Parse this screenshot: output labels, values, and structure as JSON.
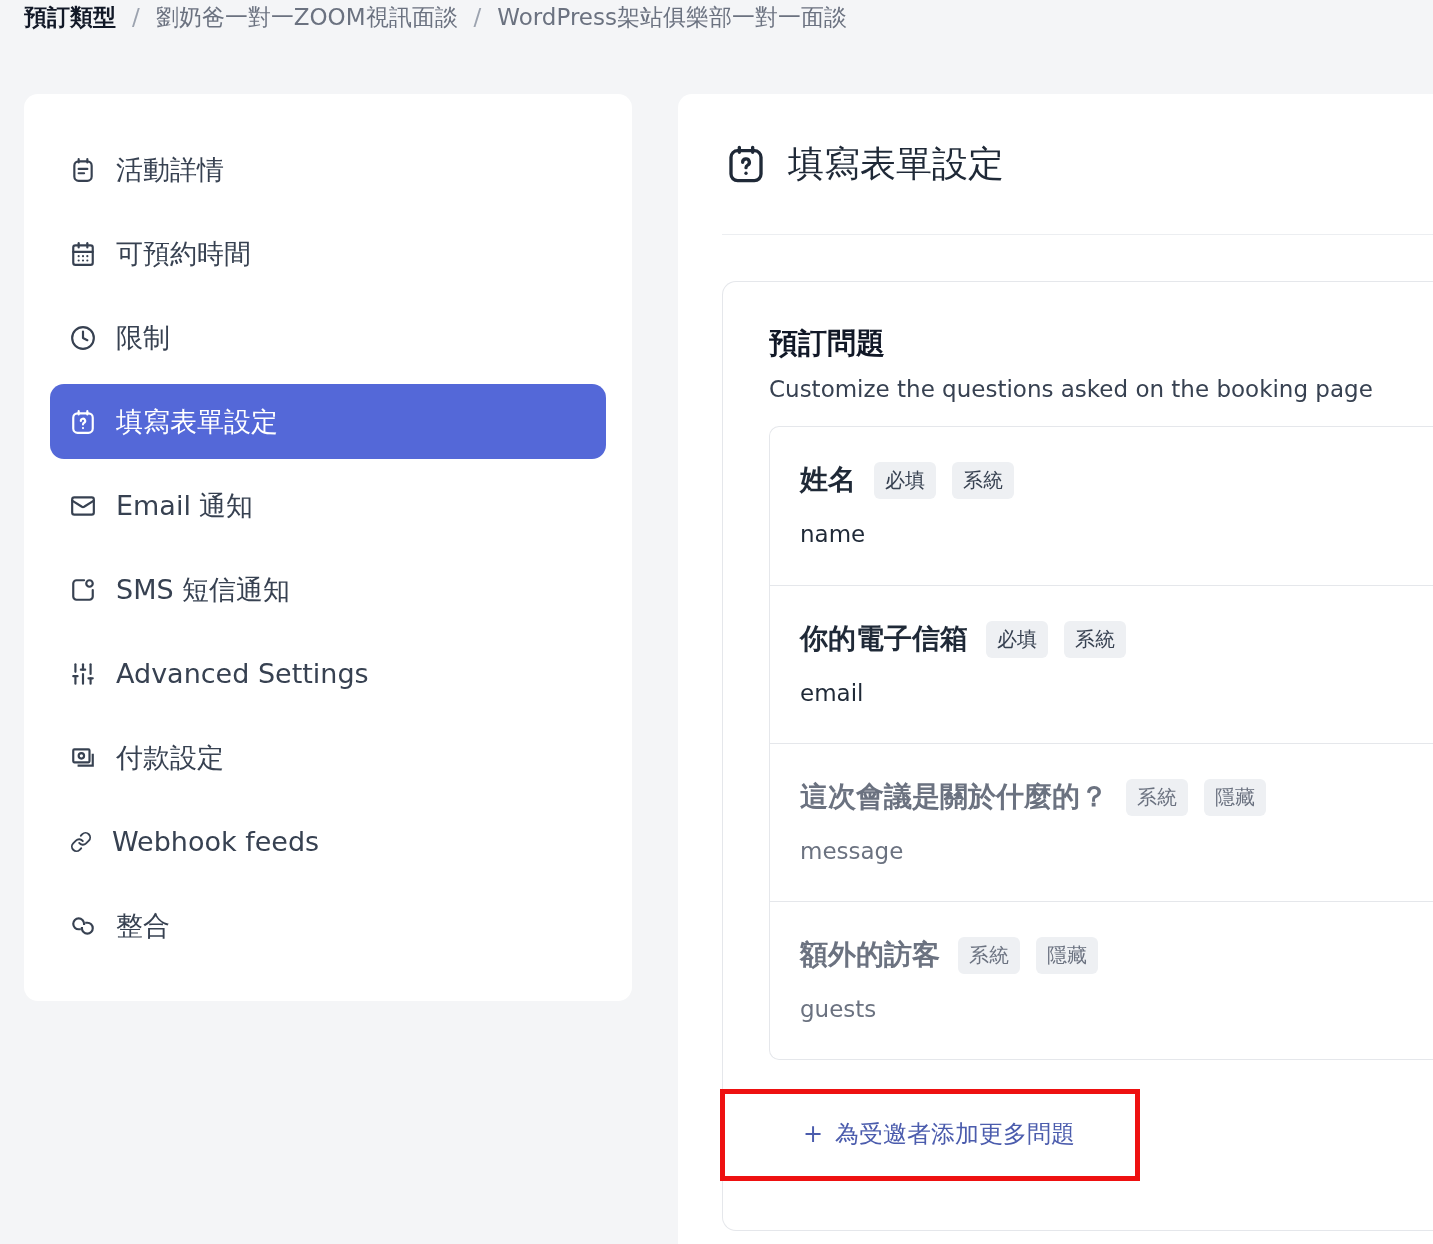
{
  "breadcrumb": [
    {
      "label": "預訂類型",
      "current": true
    },
    {
      "separator": "/",
      "label": "劉奶爸一對一ZOOM視訊面談",
      "current": false
    },
    {
      "separator": "/",
      "label": "WordPress架站俱樂部一對一面談",
      "current": false
    }
  ],
  "sidebar": {
    "items": [
      {
        "label": "活動詳情",
        "selected": false
      },
      {
        "label": "可預約時間",
        "selected": false
      },
      {
        "label": "限制",
        "selected": false
      },
      {
        "label": "填寫表單設定",
        "selected": true
      },
      {
        "label": "Email 通知",
        "selected": false
      },
      {
        "label": "SMS 短信通知",
        "selected": false
      },
      {
        "label": "Advanced Settings",
        "selected": false
      },
      {
        "label": "付款設定",
        "selected": false
      },
      {
        "label": "Webhook feeds",
        "selected": false
      },
      {
        "label": "整合",
        "selected": false
      }
    ]
  },
  "panel": {
    "title": "填寫表單設定",
    "section_title": "預訂問題",
    "section_description": "Customize the questions asked on the booking page",
    "questions": [
      {
        "label": "姓名",
        "badges": [
          "必填",
          "系統"
        ],
        "field": "name",
        "hidden": false
      },
      {
        "label": "你的電子信箱",
        "badges": [
          "必填",
          "系統"
        ],
        "field": "email",
        "hidden": false
      },
      {
        "label": "這次會議是關於什麼的？",
        "badges": [
          "系統",
          "隱藏"
        ],
        "field": "message",
        "hidden": true
      },
      {
        "label": "額外的訪客",
        "badges": [
          "系統",
          "隱藏"
        ],
        "field": "guests",
        "hidden": true
      }
    ],
    "add_button": {
      "icon": "+",
      "label": "為受邀者添加更多問題",
      "highlighted": true
    }
  }
}
